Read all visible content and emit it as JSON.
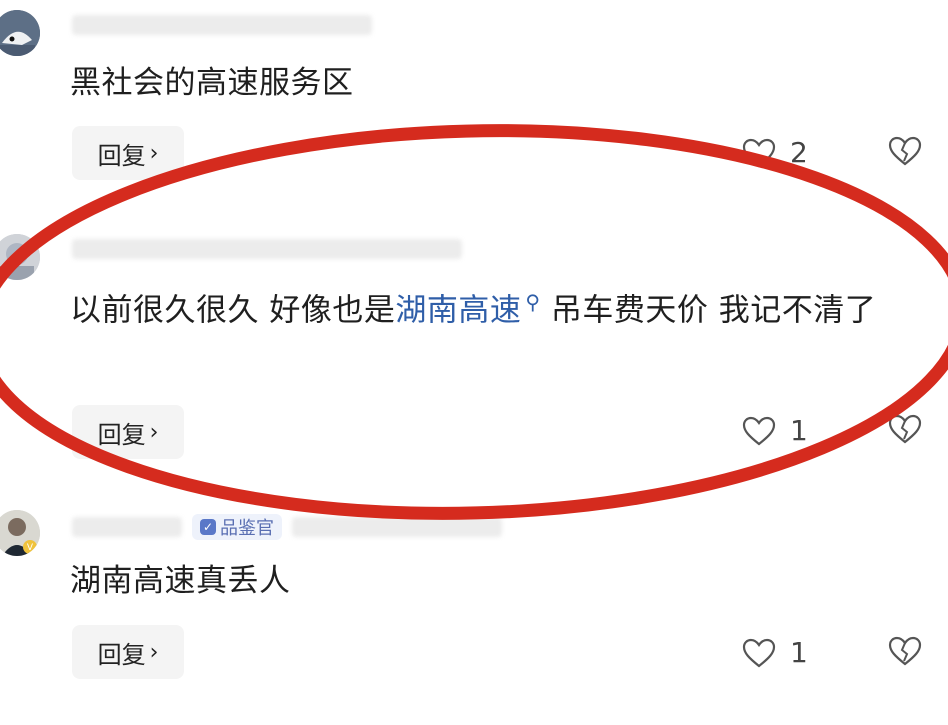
{
  "comments": [
    {
      "text": "黑社会的高速服务区",
      "reply_label": "回复",
      "like_count": "2"
    },
    {
      "text_before": "以前很久很久 好像也是",
      "link_text": "湖南高速",
      "text_after": " 吊车费天价 我记不清了",
      "reply_label": "回复",
      "like_count": "1"
    },
    {
      "badge": "品鉴官",
      "text": "湖南高速真丢人",
      "reply_label": "回复",
      "like_count": "1"
    }
  ],
  "colors": {
    "highlight_ellipse": "#d52b1e",
    "link": "#2f5ea8"
  },
  "icons": {
    "reply_chevron": "chevron-right-icon",
    "like": "heart-outline-icon",
    "dislike": "broken-heart-icon",
    "search": "search-icon"
  }
}
